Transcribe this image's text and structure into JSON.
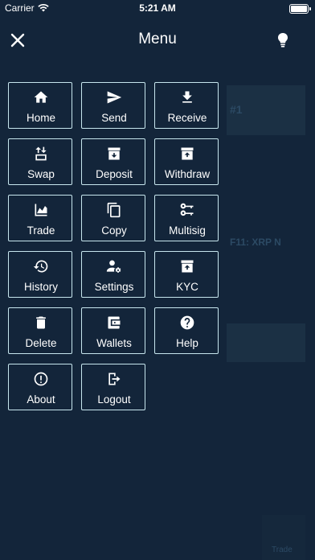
{
  "status_bar": {
    "carrier": "Carrier",
    "time": "5:21 AM"
  },
  "header": {
    "title": "Menu"
  },
  "menu": {
    "items": [
      {
        "label": "Home",
        "icon": "home-icon"
      },
      {
        "label": "Send",
        "icon": "send-icon"
      },
      {
        "label": "Receive",
        "icon": "download-icon"
      },
      {
        "label": "Swap",
        "icon": "swap-icon"
      },
      {
        "label": "Deposit",
        "icon": "deposit-box-icon"
      },
      {
        "label": "Withdraw",
        "icon": "withdraw-box-icon"
      },
      {
        "label": "Trade",
        "icon": "chart-area-icon"
      },
      {
        "label": "Copy",
        "icon": "copy-icon"
      },
      {
        "label": "Multisig",
        "icon": "keys-icon"
      },
      {
        "label": "History",
        "icon": "history-icon"
      },
      {
        "label": "Settings",
        "icon": "user-settings-icon"
      },
      {
        "label": "KYC",
        "icon": "kyc-box-icon"
      },
      {
        "label": "Delete",
        "icon": "trash-icon"
      },
      {
        "label": "Wallets",
        "icon": "wallet-icon"
      },
      {
        "label": "Help",
        "icon": "help-icon"
      },
      {
        "label": "About",
        "icon": "info-icon"
      },
      {
        "label": "Logout",
        "icon": "logout-icon"
      }
    ]
  },
  "background": {
    "account_text": "#1",
    "balance_text": "F11: XRP N",
    "footer_text": "Trade"
  }
}
